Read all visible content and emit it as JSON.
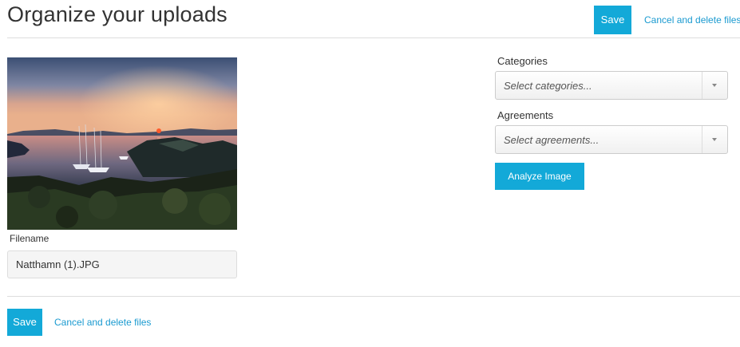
{
  "header": {
    "title": "Organize your uploads",
    "save_label": "Save",
    "cancel_label": "Cancel and delete files"
  },
  "upload": {
    "filename_label": "Filename",
    "filename_value": "Natthamn (1).JPG"
  },
  "sidebar": {
    "categories_label": "Categories",
    "categories_placeholder": "Select categories...",
    "agreements_label": "Agreements",
    "agreements_placeholder": "Select agreements...",
    "analyze_label": "Analyze Image"
  },
  "footer": {
    "save_label": "Save",
    "cancel_label": "Cancel and delete files"
  },
  "colors": {
    "accent": "#13a9d8",
    "link": "#1a9ad0"
  },
  "icons": {
    "dropdown": "caret-down-icon"
  }
}
